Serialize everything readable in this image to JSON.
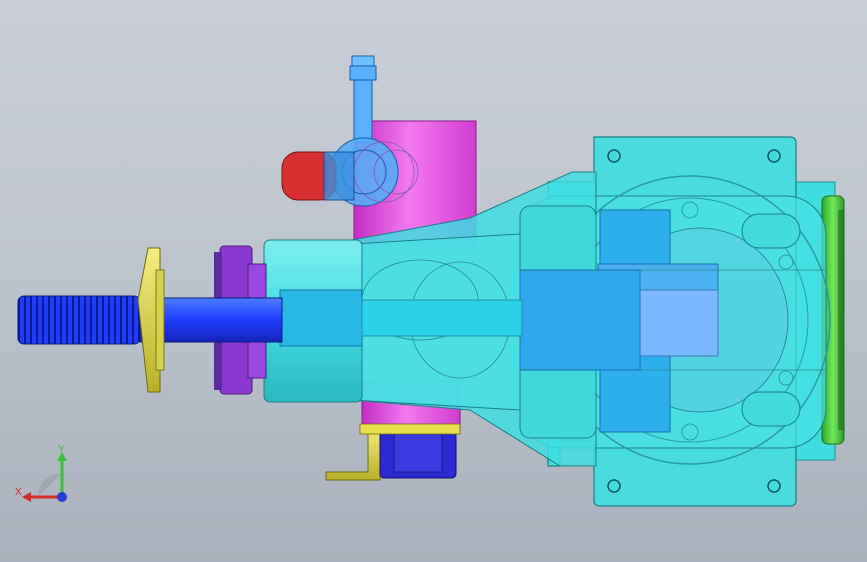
{
  "viewport": {
    "background_top": "#c9ced6",
    "background_bottom": "#aab1bc"
  },
  "model": {
    "parts": [
      "threaded-shaft",
      "yellow-flange-disc",
      "purple-gear-ring",
      "cyan-front-housing",
      "magenta-pump-body",
      "blue-hose-fitting",
      "red-connector",
      "cyan-cone-housing",
      "gearbox-body",
      "green-end-cover",
      "yellow-mount-bracket",
      "blue-mount-block"
    ],
    "colors": {
      "cyan": "#3fdde0",
      "blue": "#1e5bff",
      "dark_blue": "#2a2ad0",
      "magenta": "#e542e0",
      "yellow": "#e8e04a",
      "purple": "#8a3ad0",
      "red": "#d83030",
      "green": "#4ad43a",
      "light_blue": "#7ab8ff"
    }
  },
  "triad": {
    "y_label": "Y",
    "x_label": "X",
    "y_color": "#3bbf3b",
    "x_color": "#d42a2a",
    "z_color": "#2a3ad4"
  }
}
